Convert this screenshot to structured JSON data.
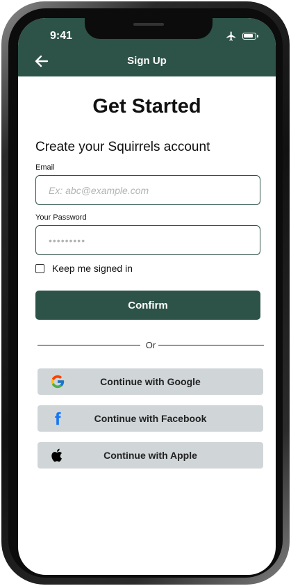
{
  "status_bar": {
    "time": "9:41"
  },
  "header": {
    "title": "Sign Up"
  },
  "main": {
    "title": "Get Started",
    "subtitle": "Create your Squirrels account",
    "email": {
      "label": "Email",
      "placeholder": "Ex: abc@example.com",
      "value": ""
    },
    "password": {
      "label": "Your Password",
      "placeholder": "•••••••••",
      "value": ""
    },
    "keep_signed_in": {
      "label": "Keep me signed in",
      "checked": false
    },
    "confirm_label": "Confirm",
    "divider_text": "Or",
    "social_buttons": [
      {
        "label": "Continue with Google",
        "icon": "google-icon"
      },
      {
        "label": "Continue with Facebook",
        "icon": "facebook-icon"
      },
      {
        "label": "Continue with Apple",
        "icon": "apple-icon"
      }
    ]
  },
  "colors": {
    "primary": "#2d5247",
    "social_button_bg": "#d0d5d8",
    "facebook_blue": "#1877f2"
  }
}
